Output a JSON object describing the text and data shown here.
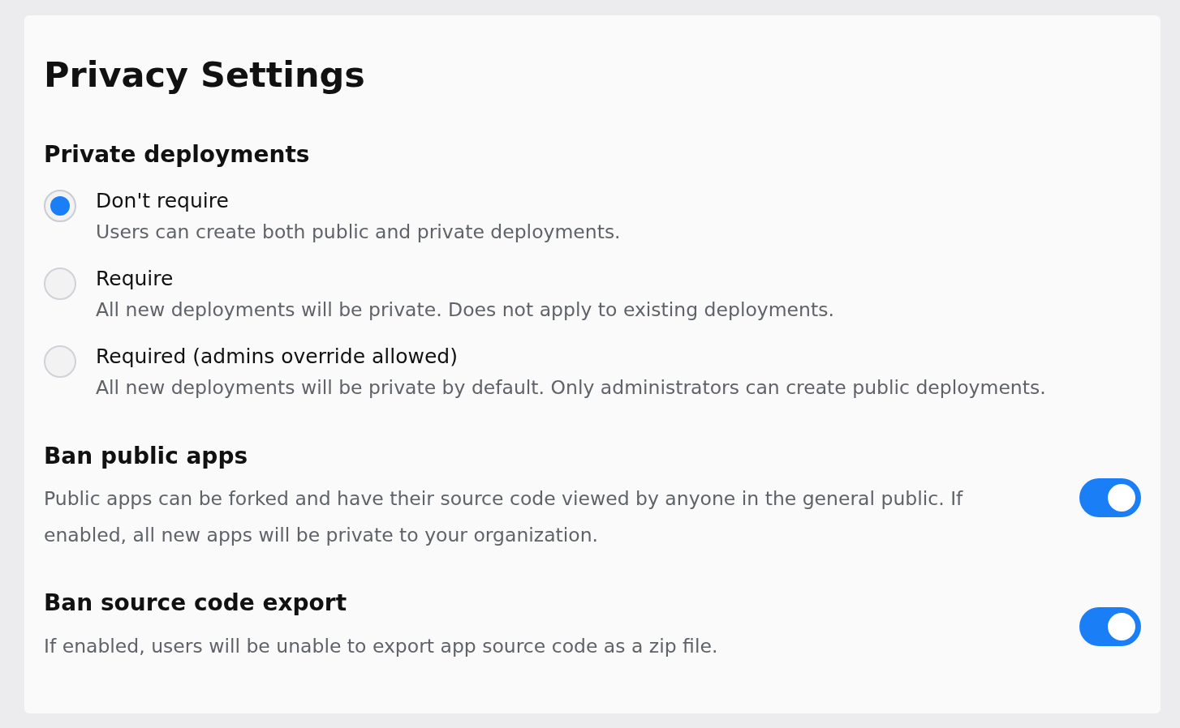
{
  "title": "Privacy Settings",
  "private_deployments": {
    "heading": "Private deployments",
    "options": [
      {
        "label": "Don't require",
        "description": "Users can create both public and private deployments.",
        "selected": true
      },
      {
        "label": "Require",
        "description": "All new deployments will be private. Does not apply to existing deployments.",
        "selected": false
      },
      {
        "label": "Required (admins override allowed)",
        "description": "All new deployments will be private by default. Only administrators can create public deployments.",
        "selected": false
      }
    ]
  },
  "toggles": [
    {
      "heading": "Ban public apps",
      "description": "Public apps can be forked and have their source code viewed by anyone in the general public. If enabled, all new apps will be private to your organization.",
      "on": true
    },
    {
      "heading": "Ban source code export",
      "description": "If enabled, users will be unable to export app source code as a zip file.",
      "on": true
    }
  ]
}
